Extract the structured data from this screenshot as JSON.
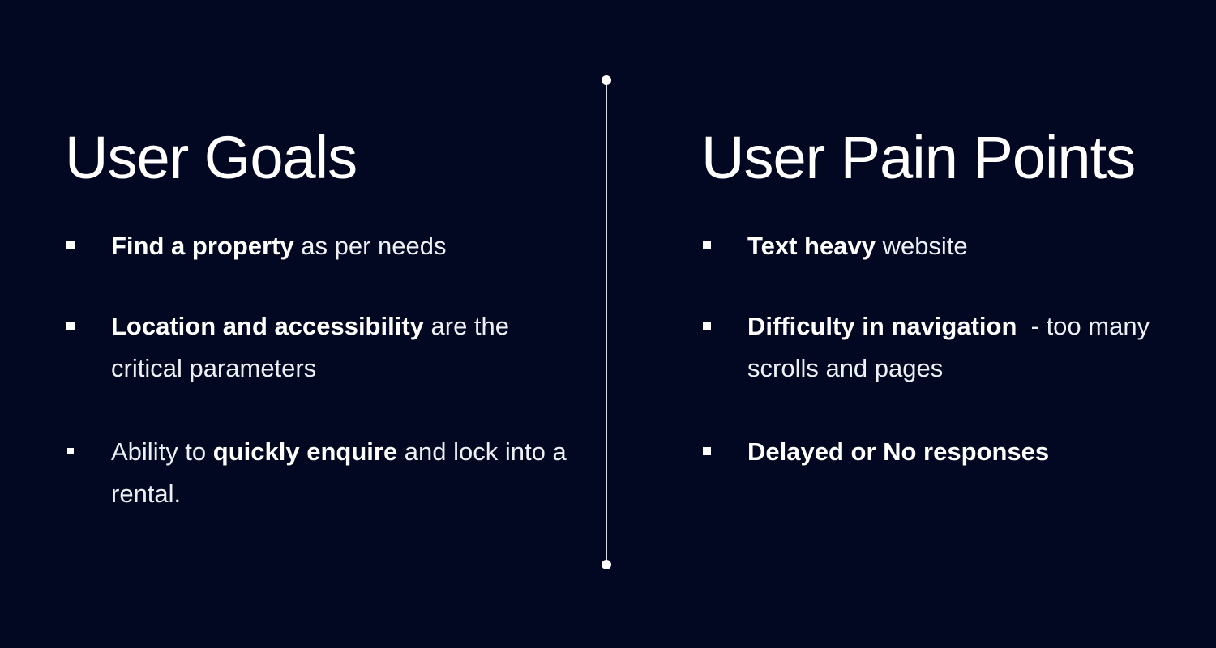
{
  "colors": {
    "background": "#030822",
    "text": "#ffffff",
    "divider": "#d9dce6"
  },
  "left": {
    "title": "User Goals",
    "items": [
      {
        "strong": "Find a property",
        "rest": " as per needs",
        "pre": ""
      },
      {
        "strong": "Location and accessibility",
        "rest": " are the critical parameters",
        "pre": ""
      },
      {
        "pre": "Ability to ",
        "strong": "quickly enquire",
        "rest": " and lock into a rental."
      }
    ]
  },
  "right": {
    "title": "User Pain Points",
    "items": [
      {
        "strong": "Text heavy",
        "rest": " website"
      },
      {
        "strong": "Difficulty in navigation",
        "rest": "  - too many scrolls and pages"
      },
      {
        "strong": "Delayed or No responses",
        "rest": ""
      }
    ]
  },
  "icons": {
    "bullet": "square-bullet-icon",
    "divider_end": "dot-icon"
  }
}
